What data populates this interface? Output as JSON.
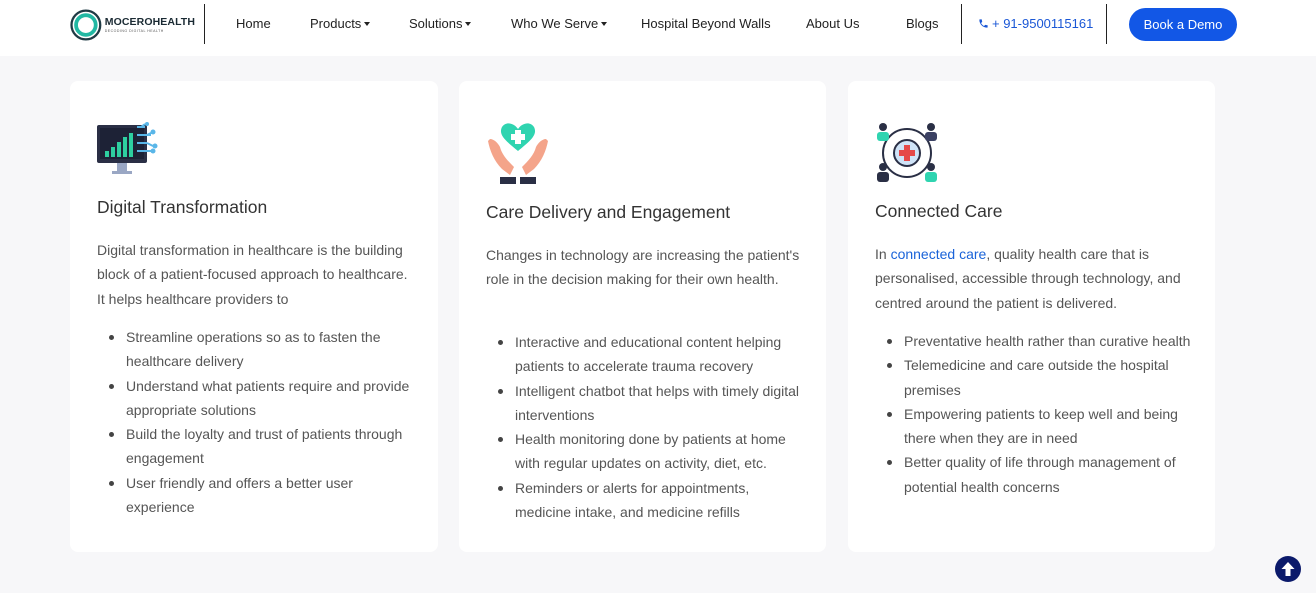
{
  "header": {
    "logo": {
      "name": "MOCEROHEALTH",
      "tagline": "DECODING DIGITAL HEALTH"
    },
    "nav": [
      {
        "label": "Home",
        "dropdown": false
      },
      {
        "label": "Products",
        "dropdown": true
      },
      {
        "label": "Solutions",
        "dropdown": true
      },
      {
        "label": "Who We Serve",
        "dropdown": true
      },
      {
        "label": "Hospital Beyond Walls",
        "dropdown": false
      },
      {
        "label": "About Us",
        "dropdown": false
      },
      {
        "label": "Blogs",
        "dropdown": false
      }
    ],
    "phone": "+ 91-9500115161",
    "cta": "Book a Demo"
  },
  "cards": [
    {
      "icon": "digital-transformation-icon",
      "title": "Digital Transformation",
      "intro": "Digital transformation in healthcare is the building block of a patient-focused approach to healthcare. It helps healthcare providers to",
      "items": [
        "Streamline operations so as to fasten the healthcare delivery",
        "Understand what patients require and provide appropriate solutions",
        "Build the loyalty and trust of patients through engagement",
        "User friendly and offers a better user experience"
      ]
    },
    {
      "icon": "care-hands-heart-icon",
      "title": "Care Delivery and Engagement",
      "intro": "Changes in technology are increasing the patient's role in the decision making for their own health.",
      "items": [
        "Interactive and educational content helping patients to accelerate trauma recovery",
        "Intelligent chatbot that helps with timely digital interventions",
        "Health monitoring done by patients at home with regular updates on activity, diet, etc.",
        "Reminders or alerts for appointments, medicine intake, and medicine refills"
      ]
    },
    {
      "icon": "connected-care-icon",
      "title": "Connected Care",
      "intro_prefix": "In ",
      "intro_link": "connected care",
      "intro_suffix": ", quality health care that is personalised, accessible through technology, and centred around the patient is delivered.",
      "items": [
        "Preventative health rather than curative health",
        "Telemedicine and care outside the hospital premises",
        "Empowering patients to keep well and being there when they are in need",
        "Better quality of life through management of potential health concerns"
      ]
    }
  ],
  "colors": {
    "accent": "#1257e6",
    "link": "#1a63d9",
    "background": "#f7f7f9",
    "scroll_top": "#0b1a6b"
  },
  "icons": {
    "phone": "phone-icon",
    "scroll_top": "arrow-up-icon"
  }
}
